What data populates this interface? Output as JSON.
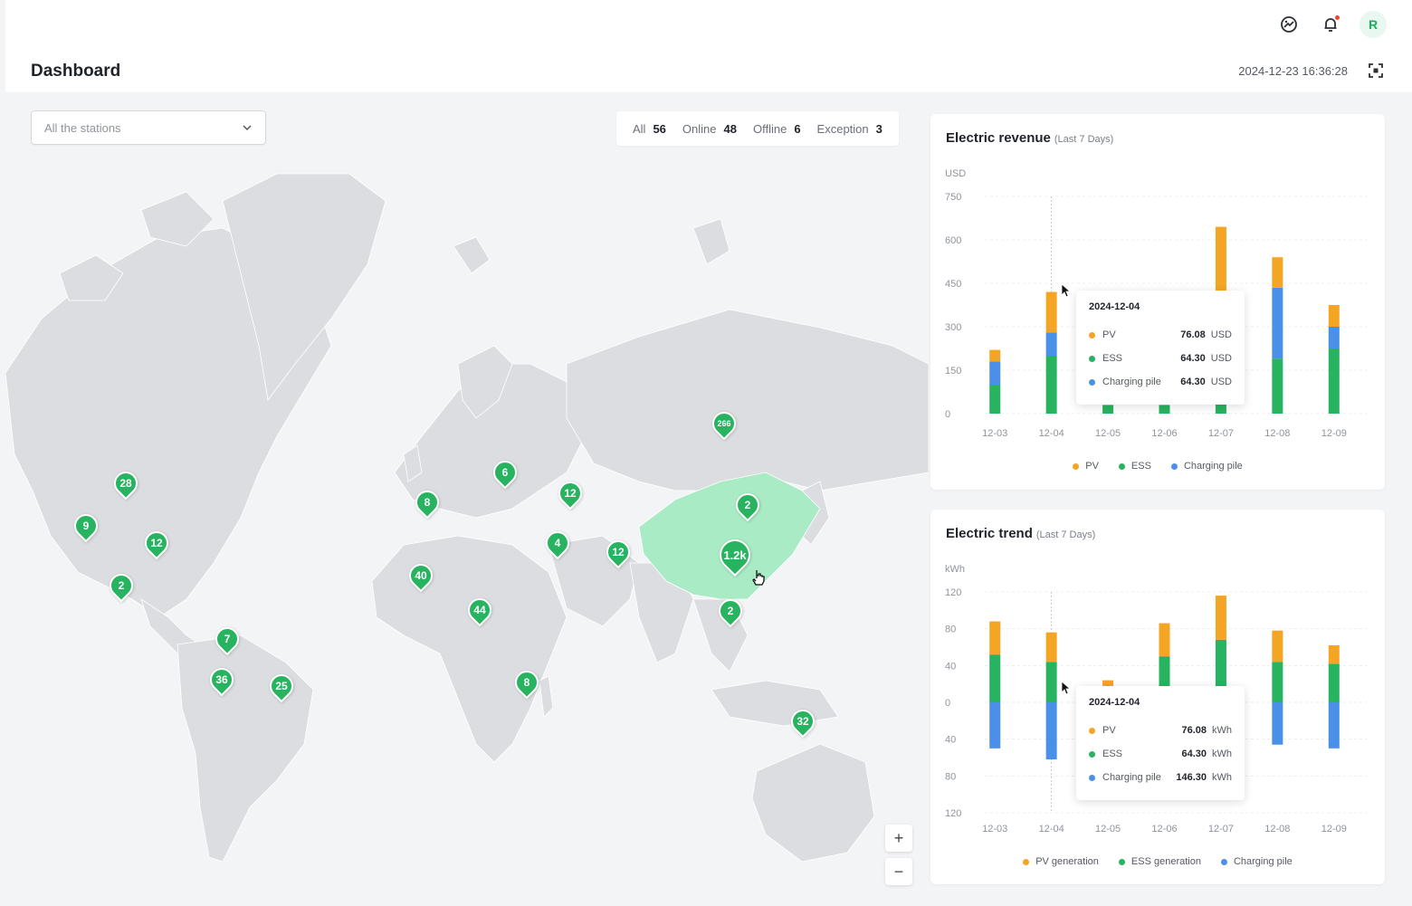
{
  "header": {
    "title": "Dashboard",
    "datetime": "2024-12-23 16:36:28",
    "avatar_initial": "R",
    "icons": [
      "help-icon",
      "bell-icon",
      "fullscreen-icon"
    ]
  },
  "filter": {
    "station_select": "All the stations"
  },
  "status": {
    "all_label": "All",
    "all_count": "56",
    "online_label": "Online",
    "online_count": "48",
    "offline_label": "Offline",
    "offline_count": "6",
    "exception_label": "Exception",
    "exception_count": "3"
  },
  "map": {
    "markers": [
      {
        "label": "28"
      },
      {
        "label": "9"
      },
      {
        "label": "12"
      },
      {
        "label": "2"
      },
      {
        "label": "7"
      },
      {
        "label": "36"
      },
      {
        "label": "25"
      },
      {
        "label": "8"
      },
      {
        "label": "6"
      },
      {
        "label": "12"
      },
      {
        "label": "4"
      },
      {
        "label": "40"
      },
      {
        "label": "44"
      },
      {
        "label": "8"
      },
      {
        "label": "12"
      },
      {
        "label": "266"
      },
      {
        "label": "2"
      },
      {
        "label": "1.2k"
      },
      {
        "label": "2"
      },
      {
        "label": "32"
      }
    ],
    "highlight_color": "#a8ebc4",
    "land_color": "#dcdde0",
    "zoom_in": "+",
    "zoom_out": "−"
  },
  "revenue": {
    "title": "Electric revenue",
    "subtitle": "(Last 7 Days)",
    "tooltip": {
      "date": "2024-12-04",
      "rows": [
        {
          "name": "PV",
          "value": "76.08",
          "unit": "USD"
        },
        {
          "name": "ESS",
          "value": "64.30",
          "unit": "USD"
        },
        {
          "name": "Charging pile",
          "value": "64.30",
          "unit": "USD"
        }
      ]
    }
  },
  "trend": {
    "title": "Electric trend",
    "subtitle": "(Last 7 Days)",
    "tooltip": {
      "date": "2024-12-04",
      "rows": [
        {
          "name": "PV",
          "value": "76.08",
          "unit": "kWh"
        },
        {
          "name": "ESS",
          "value": "64.30",
          "unit": "kWh"
        },
        {
          "name": "Charging pile",
          "value": "146.30",
          "unit": "kWh"
        }
      ]
    }
  },
  "colors": {
    "pv": "#f5a524",
    "ess": "#27b35f",
    "charging": "#4a90e8",
    "marker": "#27b35f"
  },
  "chart_data": [
    {
      "type": "bar",
      "stacked": true,
      "title": "Electric revenue",
      "ylabel": "USD",
      "ylim": [
        0,
        750
      ],
      "yticks": [
        "0",
        "150",
        "300",
        "450",
        "600",
        "750"
      ],
      "categories": [
        "12-03",
        "12-04",
        "12-05",
        "12-06",
        "12-07",
        "12-08",
        "12-09"
      ],
      "legend_position": "bottom",
      "series": [
        {
          "name": "ESS",
          "color": "#27b35f",
          "values": [
            100,
            200,
            30,
            30,
            250,
            190,
            225
          ]
        },
        {
          "name": "Charging pile",
          "color": "#4a90e8",
          "values": [
            80,
            80,
            0,
            0,
            0,
            245,
            75
          ]
        },
        {
          "name": "PV",
          "color": "#f5a524",
          "values": [
            40,
            140,
            0,
            0,
            395,
            105,
            75
          ]
        }
      ],
      "legend": [
        "PV",
        "ESS",
        "Charging pile"
      ]
    },
    {
      "type": "bar",
      "stacked": true,
      "title": "Electric trend",
      "ylabel": "kWh",
      "ylim": [
        -120,
        120
      ],
      "yticks": [
        "120",
        "80",
        "40",
        "0",
        "40",
        "80",
        "120"
      ],
      "categories": [
        "12-03",
        "12-04",
        "12-05",
        "12-06",
        "12-07",
        "12-08",
        "12-09"
      ],
      "legend_position": "bottom",
      "series": [
        {
          "name": "ESS generation",
          "color": "#27b35f",
          "values": [
            52,
            44,
            4,
            50,
            68,
            44,
            42
          ]
        },
        {
          "name": "PV generation",
          "color": "#f5a524",
          "values": [
            36,
            32,
            20,
            36,
            48,
            34,
            20
          ]
        },
        {
          "name": "Charging pile",
          "color": "#4a90e8",
          "values": [
            -50,
            -62,
            0,
            0,
            0,
            -46,
            -50
          ]
        }
      ],
      "legend": [
        "PV generation",
        "ESS generation",
        "Charging pile"
      ]
    }
  ]
}
